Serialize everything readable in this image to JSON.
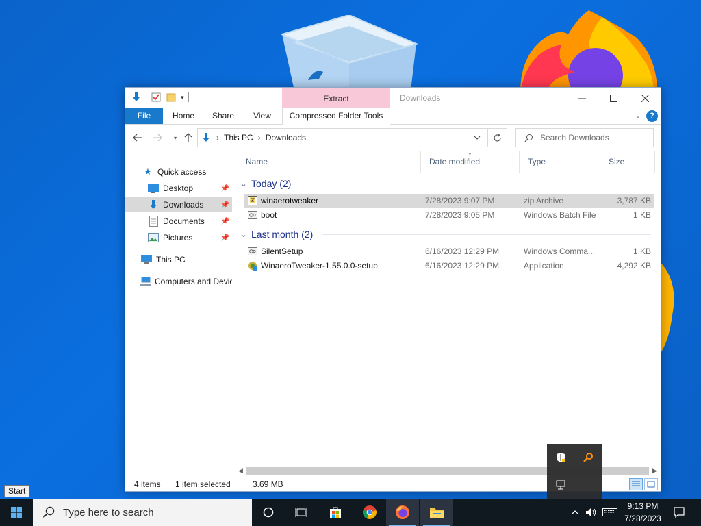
{
  "window": {
    "title": "Downloads",
    "context_tab_group": "Extract",
    "ribbon_tabs": {
      "file": "File",
      "home": "Home",
      "share": "Share",
      "view": "View",
      "compressed": "Compressed Folder Tools"
    }
  },
  "address": {
    "crumbs": [
      "This PC",
      "Downloads"
    ]
  },
  "search": {
    "placeholder": "Search Downloads"
  },
  "navpane": {
    "quick_access": "Quick access",
    "items": [
      "Desktop",
      "Downloads",
      "Documents",
      "Pictures"
    ],
    "this_pc": "This PC",
    "network": "Computers and Devices"
  },
  "columns": {
    "name": "Name",
    "date": "Date modified",
    "type": "Type",
    "size": "Size"
  },
  "groups": [
    {
      "title": "Today (2)",
      "files": [
        {
          "name": "winaerotweaker",
          "date": "7/28/2023 9:07 PM",
          "type": "zip Archive",
          "size": "3,787 KB"
        },
        {
          "name": "boot",
          "date": "7/28/2023 9:05 PM",
          "type": "Windows Batch File",
          "size": "1 KB"
        }
      ]
    },
    {
      "title": "Last month (2)",
      "files": [
        {
          "name": "SilentSetup",
          "date": "6/16/2023 12:29 PM",
          "type": "Windows Comma...",
          "size": "1 KB"
        },
        {
          "name": "WinaeroTweaker-1.55.0.0-setup",
          "date": "6/16/2023 12:29 PM",
          "type": "Application",
          "size": "4,292 KB"
        }
      ]
    }
  ],
  "status": {
    "items": "4 items",
    "selected": "1 item selected",
    "size": "3.69 MB"
  },
  "taskbar": {
    "tooltip": "Start",
    "search_placeholder": "Type here to search",
    "time": "9:13 PM",
    "date": "7/28/2023"
  },
  "colors": {
    "accent": "#1979ca",
    "context_tab": "#f8c7d8",
    "group_title": "#1e3287",
    "selection": "#d9d9d9"
  }
}
